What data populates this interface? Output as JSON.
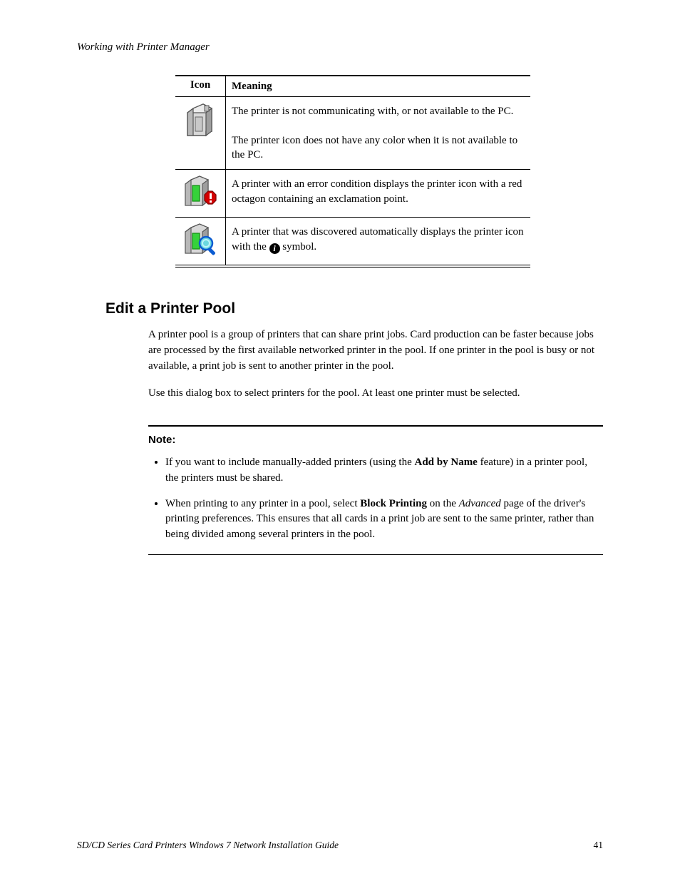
{
  "running_header": "Working with Printer Manager",
  "icon_table": {
    "header_icon": "Icon",
    "header_meaning": "Meaning",
    "rows": [
      {
        "icon_name": "Printer Not Available",
        "description_lines": [
          "The printer is not communicating with, or not available to the PC.",
          "The printer icon does not have any color when it is not available to the PC."
        ]
      },
      {
        "icon_name": "Printer Error",
        "description_lines": [
          "A printer with an error condition displays the printer icon with a red octagon containing an exclamation point."
        ]
      },
      {
        "icon_name": "Discovered Printer",
        "description_lines": [
          "A printer that was discovered automatically displays the",
          "printer icon with the",
          "symbol."
        ]
      }
    ],
    "info_badge_char": "i"
  },
  "section": {
    "title": "Edit a Printer Pool",
    "paragraphs": [
      "A printer pool is a group of printers that can share print jobs. Card production can be faster because jobs are processed by the first available networked printer in the pool. If one printer in the pool is busy or not available, a print job is sent to another printer in the pool.",
      "Use this dialog box to select printers for the pool. At least one printer must be selected."
    ]
  },
  "note": {
    "label": "Note:",
    "items": [
      {
        "pre": "If you want to include manually-added printers (using the ",
        "bold": "Add by Name",
        "post": " feature) in a printer pool, the printers must be shared."
      },
      {
        "pre": "When printing to any printer in a pool, select ",
        "bold": "Block Printing",
        "post_pre": " on the ",
        "italic": "Advanced",
        "post": " page of the driver's printing preferences. This ensures that all cards in a print job are sent to the same printer, rather than being divided among several printers in the pool."
      }
    ]
  },
  "footer": {
    "doc_title": "SD/CD Series Card Printers Windows 7 Network Installation Guide",
    "page_number": "41"
  }
}
